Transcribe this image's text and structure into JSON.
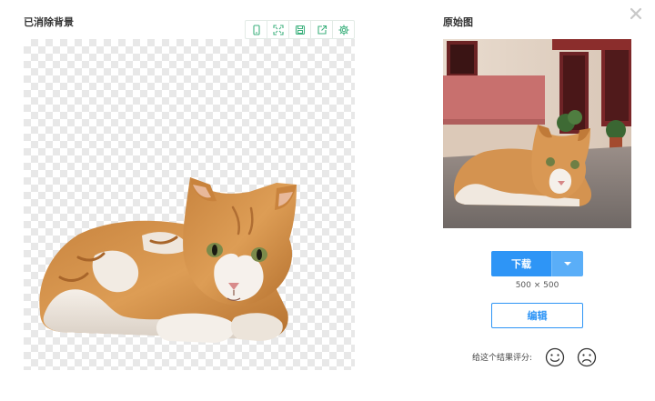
{
  "dialog": {
    "left_title": "已消除背景",
    "right_title": "原始图"
  },
  "toolbar": {
    "tools": [
      {
        "icon": "mobile-icon"
      },
      {
        "icon": "fullscreen-icon"
      },
      {
        "icon": "save-icon"
      },
      {
        "icon": "share-icon"
      },
      {
        "icon": "gear-icon"
      }
    ],
    "accent": "#3fb27f"
  },
  "actions": {
    "download_label": "下载",
    "dimensions": "500 × 500",
    "edit_label": "编辑",
    "rating_label": "给这个结果评分:"
  },
  "colors": {
    "primary": "#2e95f6",
    "primary_light": "#5aaef8"
  }
}
